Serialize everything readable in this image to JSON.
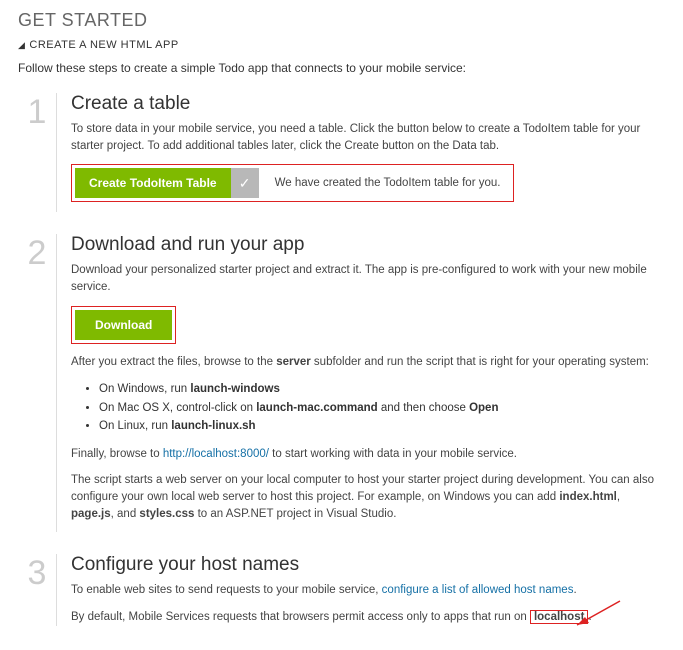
{
  "header": {
    "title": "GET STARTED",
    "subtitle": "CREATE A NEW HTML APP"
  },
  "intro": "Follow these steps to create a simple Todo app that connects to your mobile service:",
  "steps": {
    "s1": {
      "num": "1",
      "title": "Create a table",
      "desc": "To store data in your mobile service, you need a table. Click the button below to create a TodoItem table for your starter project. To add additional tables later, click the Create button on the Data tab.",
      "button": "Create TodoItem Table",
      "status": "We have created the TodoItem table for you."
    },
    "s2": {
      "num": "2",
      "title": "Download and run your app",
      "desc": "Download your personalized starter project and extract it. The app is pre-configured to work with your new mobile service.",
      "button": "Download",
      "after_extract_pre": "After you extract the files, browse to the ",
      "after_extract_bold": "server",
      "after_extract_post": " subfolder and run the script that is right for your operating system:",
      "bullets": {
        "win_pre": "On Windows, run ",
        "win_cmd": "launch-windows",
        "mac_pre": "On Mac OS X, control-click on ",
        "mac_cmd": "launch-mac.command",
        "mac_post": " and then choose ",
        "mac_open": "Open",
        "lin_pre": "On Linux, run ",
        "lin_cmd": "launch-linux.sh"
      },
      "finally_pre": "Finally, browse to ",
      "finally_link": "http://localhost:8000/",
      "finally_post": " to start working with data in your mobile service.",
      "note_pre": "The script starts a web server on your local computer to host your starter project during development. You can also configure your own local web server to host this project. For example, on Windows you can add ",
      "note_f1": "index.html",
      "note_sep1": ", ",
      "note_f2": "page.js",
      "note_sep2": ", and ",
      "note_f3": "styles.css",
      "note_post": " to an ASP.NET project in Visual Studio."
    },
    "s3": {
      "num": "3",
      "title": "Configure your host names",
      "line1_pre": "To enable web sites to send requests to your mobile service, ",
      "line1_link": "configure a list of allowed host names",
      "line1_post": ".",
      "line2_pre": "By default, Mobile Services requests that browsers permit access only to apps that run on ",
      "line2_box": "localhost",
      "line2_post": "."
    }
  }
}
